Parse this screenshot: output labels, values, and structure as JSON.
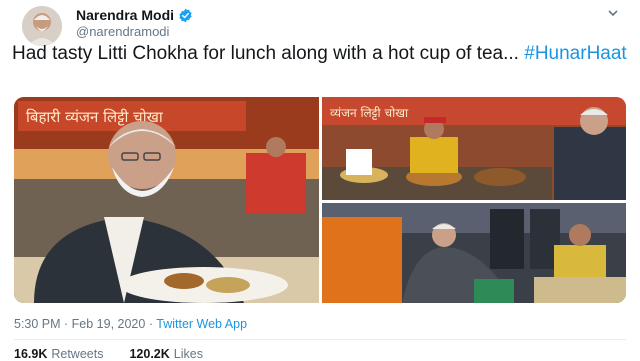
{
  "tweet": {
    "author_name": "Narendra Modi",
    "author_handle": "@narendramodi",
    "text": "Had tasty Litti Chokha for lunch along with a hot cup of tea...",
    "hashtag": "#HunarHaat",
    "timestamp": "5:30 PM · Feb 19, 2020",
    "source": "Twitter Web App",
    "retweets_count": "16.9K",
    "retweets_label": "Retweets",
    "likes_count": "120.2K",
    "likes_label": "Likes"
  },
  "photos": {
    "stall_banner_1": "बिहारी व्यंजन लिट्टी चोखा",
    "stall_banner_2": "व्यंजन लिट्टी चोखा"
  },
  "icons": {
    "verified": "verified-badge-icon",
    "more": "chevron-down-icon"
  },
  "colors": {
    "link": "#1b95e0",
    "text": "#14171a",
    "muted": "#657786"
  }
}
